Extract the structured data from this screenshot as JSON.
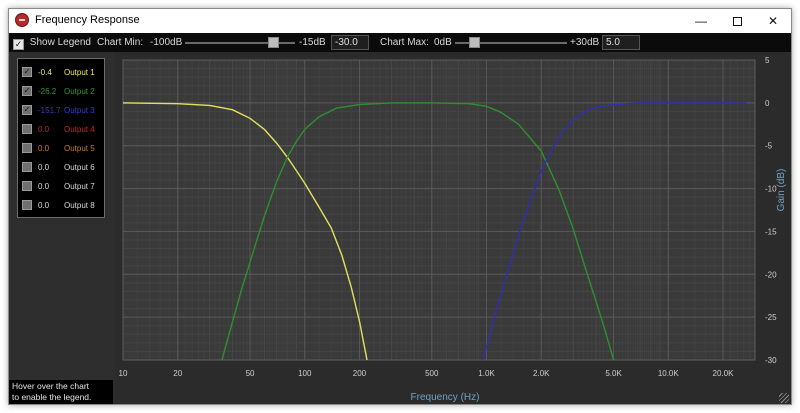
{
  "window": {
    "title": "Frequency Response",
    "close_glyph": "✕",
    "min_glyph": "—"
  },
  "toolbar": {
    "show_legend_label": "Show Legend",
    "show_legend_checked": true,
    "chart_min": {
      "label": "Chart Min:",
      "min_label": "-100dB",
      "max_label": "-15dB",
      "value": "-30.0",
      "slider_fraction": 0.8
    },
    "chart_max": {
      "label": "Chart Max:",
      "min_label": "0dB",
      "max_label": "+30dB",
      "value": "5.0",
      "slider_fraction": 0.17
    }
  },
  "legend": {
    "items": [
      {
        "checked": true,
        "value": "-0.4",
        "name": "Output 1",
        "color": "#e8e86a"
      },
      {
        "checked": true,
        "value": "-26.2",
        "name": "Output 2",
        "color": "#2e9a2e"
      },
      {
        "checked": true,
        "value": "-151.7",
        "name": "Output 3",
        "color": "#3a3acf"
      },
      {
        "checked": false,
        "value": "0.0",
        "name": "Output 4",
        "color": "#cc2222"
      },
      {
        "checked": false,
        "value": "0.0",
        "name": "Output 5",
        "color": "#c87a30"
      },
      {
        "checked": false,
        "value": "0.0",
        "name": "Output 6",
        "color": "#d8d8d8"
      },
      {
        "checked": false,
        "value": "0.0",
        "name": "Output 7",
        "color": "#d8d8d8"
      },
      {
        "checked": false,
        "value": "0.0",
        "name": "Output 8",
        "color": "#d8d8d8"
      }
    ],
    "hint_line1": "Hover over the chart",
    "hint_line2": "to enable the legend."
  },
  "chart_data": {
    "type": "line",
    "xlabel": "Frequency (Hz)",
    "ylabel": "Gain (dB)",
    "x_scale": "log",
    "xlim": [
      10,
      30000
    ],
    "ylim": [
      -30,
      5
    ],
    "grid": true,
    "x_ticks": [
      {
        "v": 10,
        "label": "10"
      },
      {
        "v": 20,
        "label": "20"
      },
      {
        "v": 50,
        "label": "50"
      },
      {
        "v": 100,
        "label": "100"
      },
      {
        "v": 200,
        "label": "200"
      },
      {
        "v": 500,
        "label": "500"
      },
      {
        "v": 1000,
        "label": "1.0K"
      },
      {
        "v": 2000,
        "label": "2.0K"
      },
      {
        "v": 5000,
        "label": "5.0K"
      },
      {
        "v": 10000,
        "label": "10.0K"
      },
      {
        "v": 20000,
        "label": "20.0K"
      }
    ],
    "y_ticks": [
      5,
      0,
      -5,
      -10,
      -15,
      -20,
      -25,
      -30
    ],
    "series": [
      {
        "name": "Output 1",
        "color": "#e2e25a",
        "x": [
          10,
          20,
          30,
          40,
          50,
          60,
          70,
          80,
          90,
          100,
          120,
          140,
          160,
          180,
          200,
          220
        ],
        "y": [
          0,
          -0.1,
          -0.3,
          -0.8,
          -1.8,
          -3.1,
          -4.7,
          -6.3,
          -7.9,
          -9.4,
          -12.2,
          -14.6,
          -17.8,
          -21.5,
          -25.5,
          -30
        ]
      },
      {
        "name": "Output 2",
        "color": "#2f8f2f",
        "x": [
          35,
          40,
          45,
          50,
          60,
          70,
          80,
          90,
          100,
          120,
          150,
          200,
          300,
          500,
          800,
          1000,
          1200,
          1500,
          2000,
          2500,
          3000,
          3500,
          4000,
          4500,
          5000
        ],
        "y": [
          -30,
          -25.6,
          -21.7,
          -18.6,
          -13.2,
          -9.2,
          -6.4,
          -4.5,
          -3.1,
          -1.6,
          -0.6,
          -0.2,
          0,
          0,
          -0.1,
          -0.4,
          -1.1,
          -2.5,
          -5.6,
          -10.1,
          -14.7,
          -19.3,
          -23.1,
          -26.6,
          -30
        ]
      },
      {
        "name": "Output 3",
        "color": "#2e2eb8",
        "x": [
          950,
          1000,
          1100,
          1200,
          1400,
          1600,
          1800,
          2000,
          2300,
          2600,
          3000,
          3500,
          4000,
          5000,
          7000,
          10000,
          20000,
          27000
        ],
        "y": [
          -30,
          -28.5,
          -25.2,
          -22.4,
          -17.6,
          -13.6,
          -10.6,
          -8.0,
          -5.3,
          -3.5,
          -2.0,
          -1.0,
          -0.5,
          -0.2,
          0,
          0,
          0,
          0
        ]
      }
    ]
  }
}
